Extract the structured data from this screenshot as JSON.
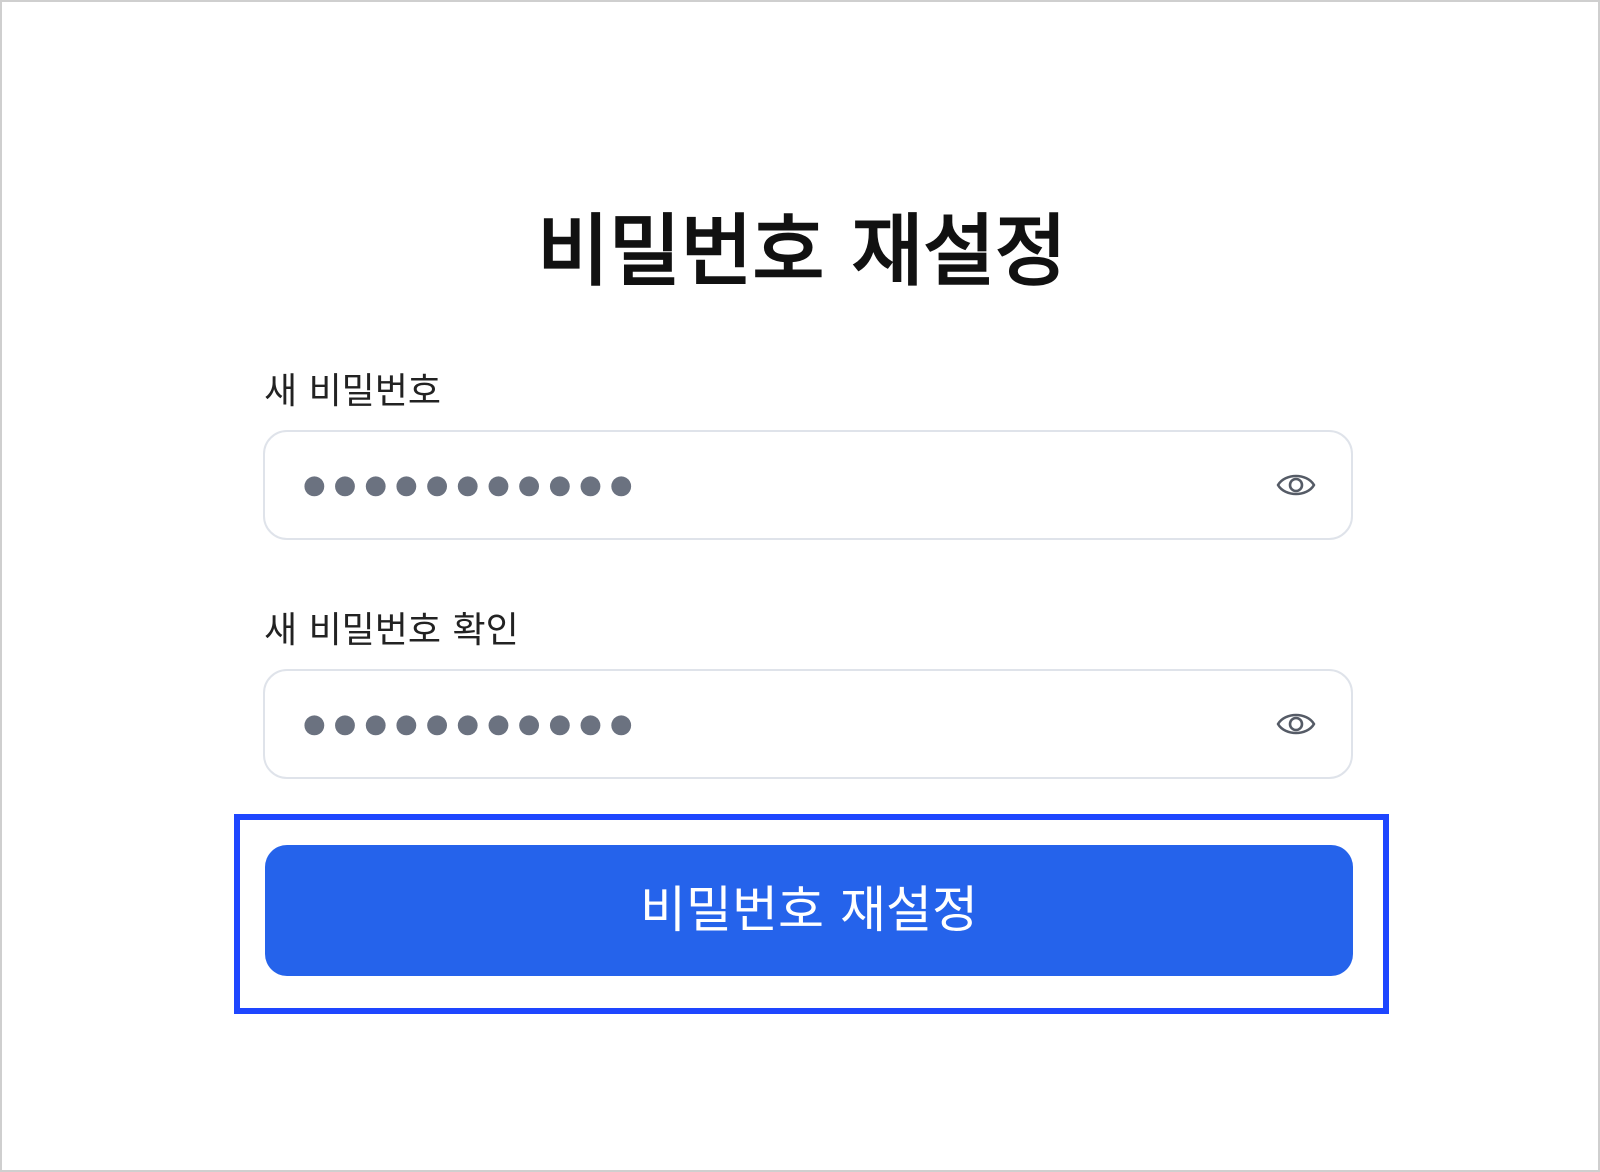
{
  "page": {
    "title": "비밀번호 재설정"
  },
  "form": {
    "new_password": {
      "label": "새 비밀번호",
      "value": "●●●●●●●●●●●",
      "icon": "eye-icon"
    },
    "confirm_password": {
      "label": "새 비밀번호 확인",
      "value": "●●●●●●●●●●●",
      "icon": "eye-icon"
    },
    "submit_label": "비밀번호 재설정"
  },
  "colors": {
    "primary": "#2563eb",
    "focus_ring": "#1e46ff",
    "input_border": "#dfe3ea",
    "title_text": "#111111",
    "masked_text": "#6b7280"
  }
}
